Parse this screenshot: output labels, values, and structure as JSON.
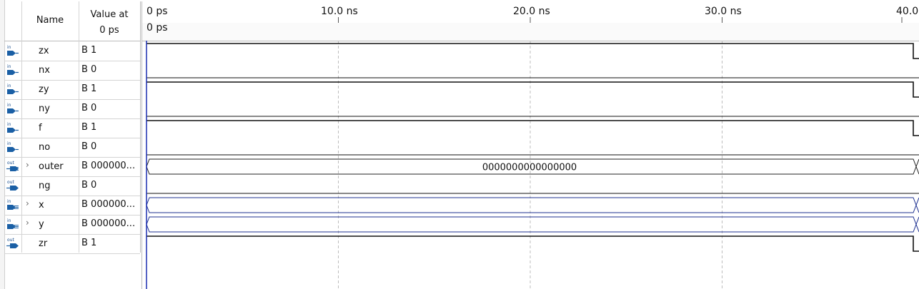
{
  "header": {
    "name_label": "Name",
    "value_label": "Value at",
    "value_time": "0 ps"
  },
  "ruler": {
    "ticks": [
      "0 ps",
      "10.0 ns",
      "20.0 ns",
      "30.0 ns",
      "40.0"
    ],
    "cursor_label": "0 ps"
  },
  "signals": [
    {
      "name": "zx",
      "dir": "in",
      "value": "B 1"
    },
    {
      "name": "nx",
      "dir": "in",
      "value": "B 0"
    },
    {
      "name": "zy",
      "dir": "in",
      "value": "B 1"
    },
    {
      "name": "ny",
      "dir": "in",
      "value": "B 0"
    },
    {
      "name": "f",
      "dir": "in",
      "value": "B 1"
    },
    {
      "name": "no",
      "dir": "in",
      "value": "B 0"
    },
    {
      "name": "outer",
      "dir": "out",
      "value": "B 000000...",
      "bus": true
    },
    {
      "name": "ng",
      "dir": "out",
      "value": "B 0"
    },
    {
      "name": "x",
      "dir": "in",
      "value": "B 000000...",
      "bus": true
    },
    {
      "name": "y",
      "dir": "in",
      "value": "B 000000...",
      "bus": true
    },
    {
      "name": "zr",
      "dir": "out",
      "value": "B 1"
    }
  ],
  "bus_label": "0000000000000000",
  "colors": {
    "wave": "#111111",
    "bus_outline": "#1c2f8f",
    "cursor": "#1c2fb0",
    "grid": "#bdbdbd"
  }
}
